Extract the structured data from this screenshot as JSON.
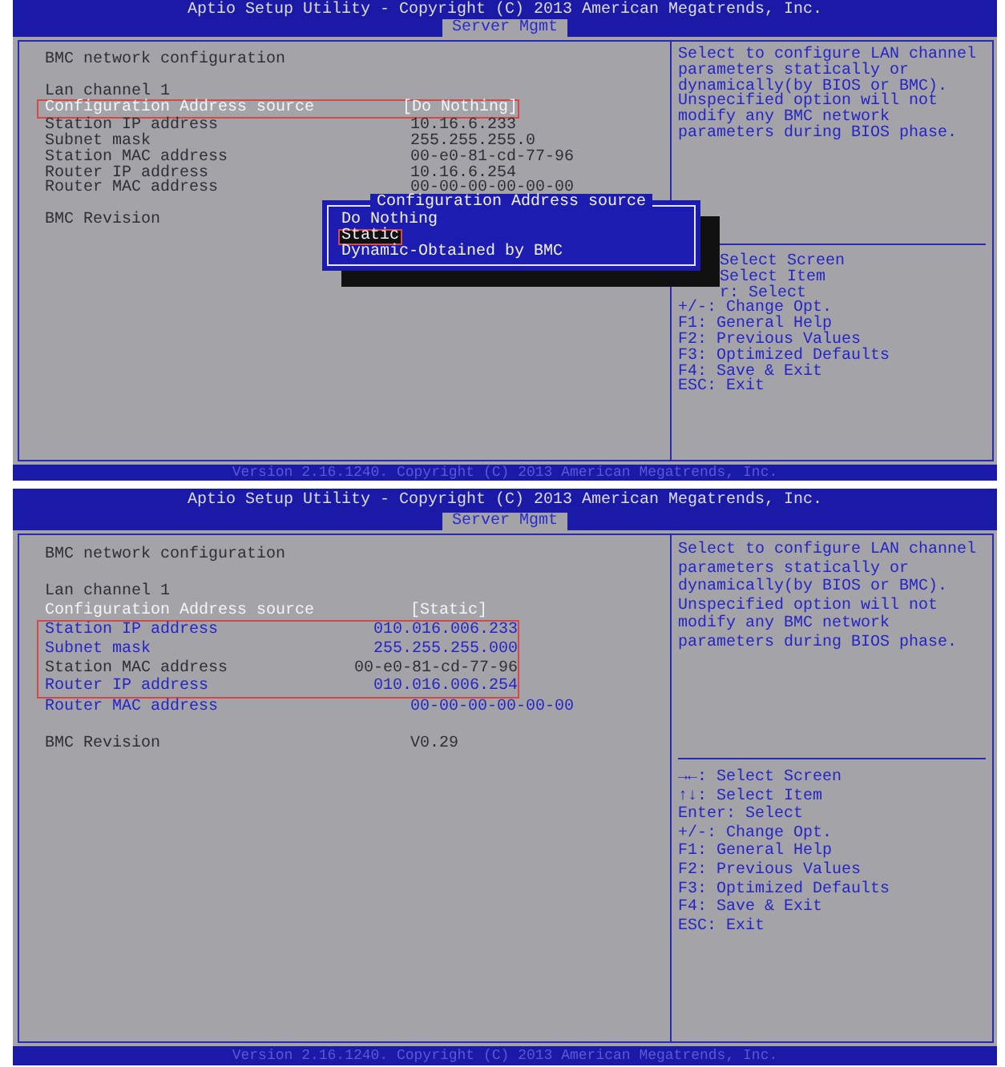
{
  "screens": [
    {
      "title": "Aptio Setup Utility - Copyright (C) 2013 American Megatrends, Inc.",
      "tabs": [
        {
          "label": "Server Mgmt",
          "selected": true
        }
      ],
      "sections": [
        {
          "rows": [
            {
              "kind": "text",
              "label": "BMC network configuration"
            }
          ]
        },
        {
          "rows": [
            {
              "kind": "text",
              "label": "Lan channel 1"
            },
            {
              "kind": "setting",
              "label": "Configuration Address source",
              "value": "[Do Nothing]",
              "selected": true,
              "editable": false,
              "outlined": true
            },
            {
              "kind": "setting",
              "label": "Station IP address",
              "value": "10.16.6.233",
              "selected": false,
              "editable": false,
              "outlined": false
            },
            {
              "kind": "setting",
              "label": "Subnet mask",
              "value": "255.255.255.0",
              "selected": false,
              "editable": false,
              "outlined": false
            },
            {
              "kind": "setting",
              "label": "Station MAC address",
              "value": "00-e0-81-cd-77-96",
              "selected": false,
              "editable": false,
              "outlined": false
            },
            {
              "kind": "setting",
              "label": "Router IP address",
              "value": "10.16.6.254",
              "selected": false,
              "editable": false,
              "outlined": false
            },
            {
              "kind": "setting",
              "label": "Router MAC address",
              "value": "00-00-00-00-00-00",
              "selected": false,
              "editable": false,
              "outlined": false
            }
          ]
        },
        {
          "rows": [
            {
              "kind": "text",
              "label": "BMC Revision"
            }
          ]
        }
      ],
      "help": "Select to configure LAN channel parameters statically or dynamically(by BIOS or BMC). Unspecified option will not modify any BMC network parameters during BIOS phase.",
      "keys": [
        {
          "text": "Select Screen",
          "covered": true
        },
        {
          "text": "Select Item",
          "covered": true
        },
        {
          "text": "r: Select",
          "covered": true
        },
        {
          "text": "+/-: Change Opt.",
          "covered": false
        },
        {
          "text": "F1: General Help",
          "covered": false
        },
        {
          "text": "F2: Previous Values",
          "covered": false
        },
        {
          "text": "F3: Optimized Defaults",
          "covered": false
        },
        {
          "text": "F4: Save & Exit",
          "covered": false
        },
        {
          "text": "ESC: Exit",
          "covered": false
        }
      ],
      "popup": {
        "title": "Configuration Address source",
        "options": [
          {
            "label": "Do Nothing",
            "selected": false
          },
          {
            "label": "Static",
            "selected": true
          },
          {
            "label": "Dynamic-Obtained by BMC",
            "selected": false
          }
        ]
      },
      "footer": "Version 2.16.1240. Copyright (C) 2013 American Megatrends, Inc."
    },
    {
      "title": "Aptio Setup Utility - Copyright (C) 2013 American Megatrends, Inc.",
      "tabs": [
        {
          "label": "Server Mgmt",
          "selected": true
        }
      ],
      "sections": [
        {
          "rows": [
            {
              "kind": "text",
              "label": "BMC network configuration"
            }
          ]
        },
        {
          "rows": [
            {
              "kind": "text",
              "label": "Lan channel 1"
            },
            {
              "kind": "setting",
              "label": "Configuration Address source",
              "value": "[Static]",
              "selected": true,
              "editable": false,
              "outlined": false
            },
            {
              "kind": "setting",
              "label": "Station IP address",
              "value": "010.016.006.233",
              "selected": false,
              "editable": true,
              "outlined": true
            },
            {
              "kind": "setting",
              "label": "Subnet mask",
              "value": "255.255.255.000",
              "selected": false,
              "editable": true,
              "outlined": true
            },
            {
              "kind": "setting",
              "label": "Station MAC address",
              "value": "00-e0-81-cd-77-96",
              "selected": false,
              "editable": false,
              "outlined": true
            },
            {
              "kind": "setting",
              "label": "Router IP address",
              "value": "010.016.006.254",
              "selected": false,
              "editable": true,
              "outlined": true
            },
            {
              "kind": "setting",
              "label": "Router MAC address",
              "value": "00-00-00-00-00-00",
              "selected": false,
              "editable": true,
              "outlined": false
            }
          ]
        },
        {
          "rows": [
            {
              "kind": "setting",
              "label": "BMC Revision",
              "value": "V0.29",
              "selected": false,
              "editable": false,
              "outlined": false
            }
          ]
        }
      ],
      "help": "Select to configure LAN channel parameters statically or dynamically(by BIOS or BMC). Unspecified option will not modify any BMC network parameters during BIOS phase.",
      "keys": [
        {
          "text": "→←: Select Screen",
          "covered": false
        },
        {
          "text": "↑↓: Select Item",
          "covered": false
        },
        {
          "text": "Enter: Select",
          "covered": false
        },
        {
          "text": "+/-: Change Opt.",
          "covered": false
        },
        {
          "text": "F1: General Help",
          "covered": false
        },
        {
          "text": "F2: Previous Values",
          "covered": false
        },
        {
          "text": "F3: Optimized Defaults",
          "covered": false
        },
        {
          "text": "F4: Save & Exit",
          "covered": false
        },
        {
          "text": "ESC: Exit",
          "covered": false
        }
      ],
      "footer": "Version 2.16.1240. Copyright (C) 2013 American Megatrends, Inc."
    }
  ]
}
